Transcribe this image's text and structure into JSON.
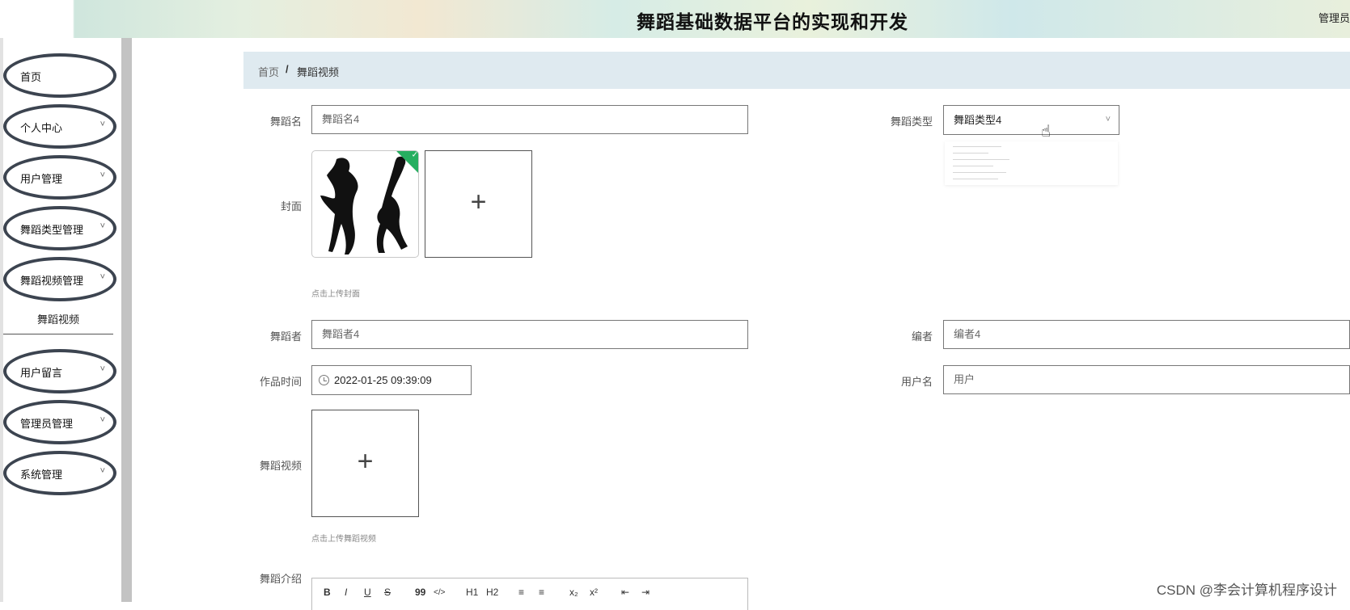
{
  "app": {
    "title": "舞蹈基础数据平台的实现和开发",
    "admin_label": "管理员"
  },
  "sidebar": {
    "items": [
      {
        "label": "首页",
        "has_children": false
      },
      {
        "label": "个人中心",
        "has_children": true
      },
      {
        "label": "用户管理",
        "has_children": true
      },
      {
        "label": "舞蹈类型管理",
        "has_children": true
      },
      {
        "label": "舞蹈视频管理",
        "has_children": true
      },
      {
        "label": "用户留言",
        "has_children": true
      },
      {
        "label": "管理员管理",
        "has_children": true
      },
      {
        "label": "系统管理",
        "has_children": true
      }
    ],
    "active_subitem": "舞蹈视频",
    "chevron": "˅"
  },
  "breadcrumb": {
    "home": "首页",
    "separator": "/",
    "current": "舞蹈视频"
  },
  "form": {
    "dance_name": {
      "label": "舞蹈名",
      "value": "舞蹈名4"
    },
    "dance_type": {
      "label": "舞蹈类型",
      "value": "舞蹈类型4"
    },
    "cover": {
      "label": "封面",
      "hint": "点击上传封面"
    },
    "dancer": {
      "label": "舞蹈者",
      "value": "舞蹈者4"
    },
    "choreographer": {
      "label": "编者",
      "value": "编者4"
    },
    "work_time": {
      "label": "作品时间",
      "value": "2022-01-25 09:39:09"
    },
    "username": {
      "label": "用户名",
      "value": "用户"
    },
    "video": {
      "label": "舞蹈视频",
      "hint": "点击上传舞蹈视频"
    },
    "intro": {
      "label": "舞蹈介绍"
    }
  },
  "editor_toolbar": [
    "B",
    "I",
    "U",
    "S",
    "99",
    "</>",
    "H1",
    "H2",
    "≡",
    "≡",
    "x₂",
    "x²",
    "⇤",
    "⇥"
  ],
  "watermark": "CSDN @李会计算机程序设计",
  "colors": {
    "nav_border": "#3c4450",
    "breadcrumb_bg": "#dfeaf0",
    "success": "#27ae60"
  }
}
